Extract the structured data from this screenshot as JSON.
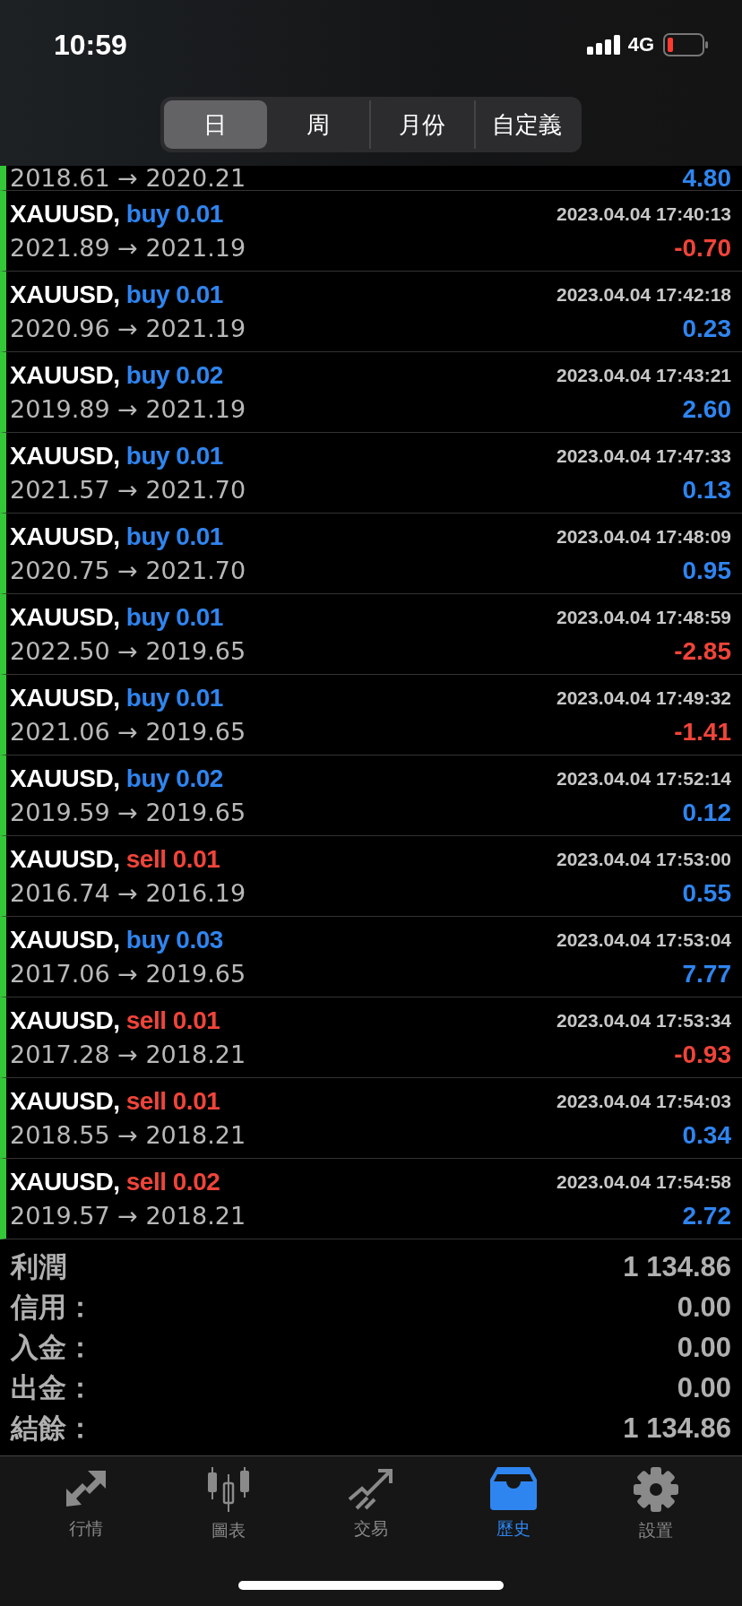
{
  "status_bar": {
    "time": "10:59",
    "network": "4G"
  },
  "period_tabs": [
    {
      "label": "日",
      "selected": true
    },
    {
      "label": "周",
      "selected": false
    },
    {
      "label": "月份",
      "selected": false
    },
    {
      "label": "自定義",
      "selected": false
    }
  ],
  "partial_row": {
    "prices": "2018.61 → 2020.21",
    "profit": {
      "text": "4.80",
      "color": "#2f85f0"
    }
  },
  "trades": [
    {
      "symbol": "XAUUSD,",
      "order": {
        "text": "buy 0.01",
        "color": "#2f85f0"
      },
      "time": "2023.04.04 17:40:13",
      "prices": "2021.89 → 2021.19",
      "profit": {
        "text": "-0.70",
        "color": "#f0443a"
      }
    },
    {
      "symbol": "XAUUSD,",
      "order": {
        "text": "buy 0.01",
        "color": "#2f85f0"
      },
      "time": "2023.04.04 17:42:18",
      "prices": "2020.96 → 2021.19",
      "profit": {
        "text": "0.23",
        "color": "#2f85f0"
      }
    },
    {
      "symbol": "XAUUSD,",
      "order": {
        "text": "buy 0.02",
        "color": "#2f85f0"
      },
      "time": "2023.04.04 17:43:21",
      "prices": "2019.89 → 2021.19",
      "profit": {
        "text": "2.60",
        "color": "#2f85f0"
      }
    },
    {
      "symbol": "XAUUSD,",
      "order": {
        "text": "buy 0.01",
        "color": "#2f85f0"
      },
      "time": "2023.04.04 17:47:33",
      "prices": "2021.57 → 2021.70",
      "profit": {
        "text": "0.13",
        "color": "#2f85f0"
      }
    },
    {
      "symbol": "XAUUSD,",
      "order": {
        "text": "buy 0.01",
        "color": "#2f85f0"
      },
      "time": "2023.04.04 17:48:09",
      "prices": "2020.75 → 2021.70",
      "profit": {
        "text": "0.95",
        "color": "#2f85f0"
      }
    },
    {
      "symbol": "XAUUSD,",
      "order": {
        "text": "buy 0.01",
        "color": "#2f85f0"
      },
      "time": "2023.04.04 17:48:59",
      "prices": "2022.50 → 2019.65",
      "profit": {
        "text": "-2.85",
        "color": "#f0443a"
      }
    },
    {
      "symbol": "XAUUSD,",
      "order": {
        "text": "buy 0.01",
        "color": "#2f85f0"
      },
      "time": "2023.04.04 17:49:32",
      "prices": "2021.06 → 2019.65",
      "profit": {
        "text": "-1.41",
        "color": "#f0443a"
      }
    },
    {
      "symbol": "XAUUSD,",
      "order": {
        "text": "buy 0.02",
        "color": "#2f85f0"
      },
      "time": "2023.04.04 17:52:14",
      "prices": "2019.59 → 2019.65",
      "profit": {
        "text": "0.12",
        "color": "#2f85f0"
      }
    },
    {
      "symbol": "XAUUSD,",
      "order": {
        "text": "sell 0.01",
        "color": "#f0443a"
      },
      "time": "2023.04.04 17:53:00",
      "prices": "2016.74 → 2016.19",
      "profit": {
        "text": "0.55",
        "color": "#2f85f0"
      }
    },
    {
      "symbol": "XAUUSD,",
      "order": {
        "text": "buy 0.03",
        "color": "#2f85f0"
      },
      "time": "2023.04.04 17:53:04",
      "prices": "2017.06 → 2019.65",
      "profit": {
        "text": "7.77",
        "color": "#2f85f0"
      }
    },
    {
      "symbol": "XAUUSD,",
      "order": {
        "text": "sell 0.01",
        "color": "#f0443a"
      },
      "time": "2023.04.04 17:53:34",
      "prices": "2017.28 → 2018.21",
      "profit": {
        "text": "-0.93",
        "color": "#f0443a"
      }
    },
    {
      "symbol": "XAUUSD,",
      "order": {
        "text": "sell 0.01",
        "color": "#f0443a"
      },
      "time": "2023.04.04 17:54:03",
      "prices": "2018.55 → 2018.21",
      "profit": {
        "text": "0.34",
        "color": "#2f85f0"
      }
    },
    {
      "symbol": "XAUUSD,",
      "order": {
        "text": "sell 0.02",
        "color": "#f0443a"
      },
      "time": "2023.04.04 17:54:58",
      "prices": "2019.57 → 2018.21",
      "profit": {
        "text": "2.72",
        "color": "#2f85f0"
      }
    }
  ],
  "summary": [
    {
      "label": "利潤",
      "value": "1 134.86"
    },
    {
      "label": "信用：",
      "value": "0.00"
    },
    {
      "label": "入金：",
      "value": "0.00"
    },
    {
      "label": "出金：",
      "value": "0.00"
    },
    {
      "label": "結餘：",
      "value": "1 134.86"
    }
  ],
  "bottom_tabs": [
    {
      "kind": "quotes",
      "label": "行情",
      "selected": false
    },
    {
      "kind": "chart",
      "label": "圖表",
      "selected": false
    },
    {
      "kind": "trade",
      "label": "交易",
      "selected": false
    },
    {
      "kind": "history",
      "label": "歷史",
      "selected": true
    },
    {
      "kind": "settings",
      "label": "設置",
      "selected": false
    }
  ]
}
